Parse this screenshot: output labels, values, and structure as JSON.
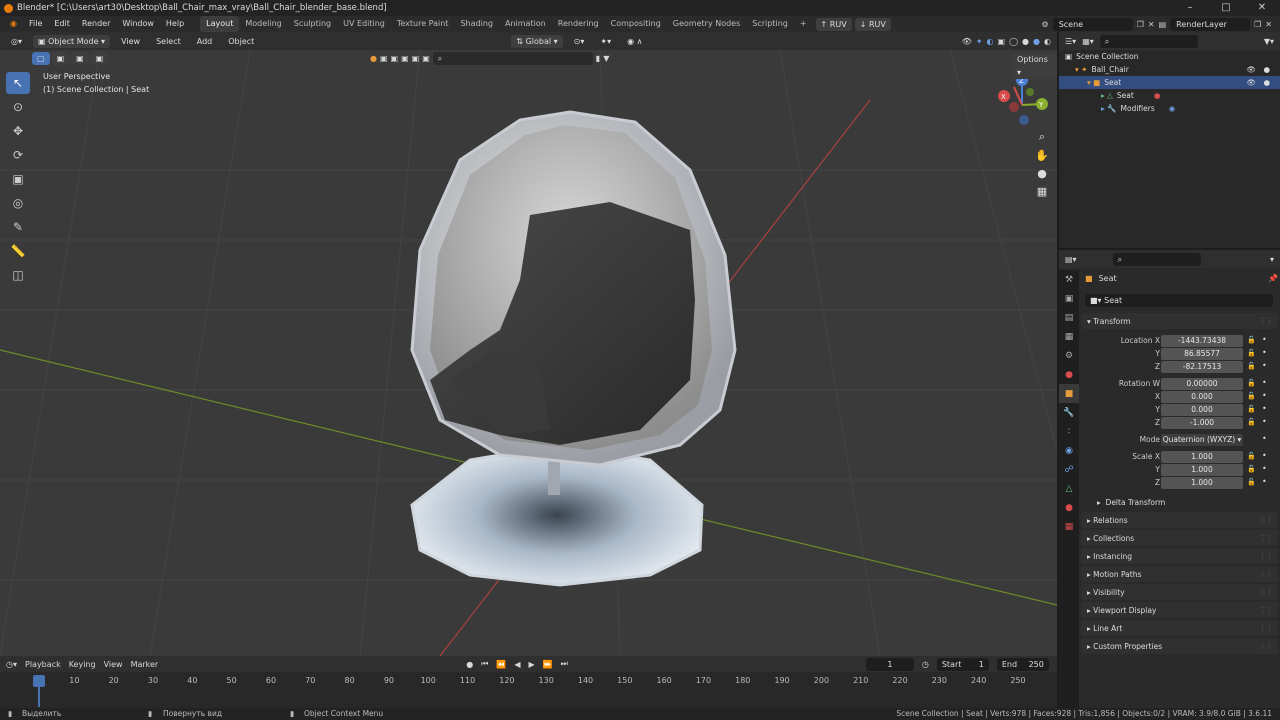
{
  "title": "Blender* [C:\\Users\\art30\\Desktop\\Ball_Chair_max_vray\\Ball_Chair_blender_base.blend]",
  "menu": [
    "File",
    "Edit",
    "Render",
    "Window",
    "Help"
  ],
  "workspaces": [
    "Layout",
    "Modeling",
    "Sculpting",
    "UV Editing",
    "Texture Paint",
    "Shading",
    "Animation",
    "Rendering",
    "Compositing",
    "Geometry Nodes",
    "Scripting"
  ],
  "ruv_buttons": [
    "RUV",
    "RUV"
  ],
  "scene": "Scene",
  "render_layer": "RenderLayer",
  "viewport_header": {
    "mode": "Object Mode",
    "menus": [
      "View",
      "Select",
      "Add",
      "Object"
    ],
    "orientation": "Global",
    "options": "Options"
  },
  "viewport": {
    "perspective": "User Perspective",
    "collection_info": "(1) Scene Collection | Seat"
  },
  "gizmo": {
    "x": "X",
    "y": "Y",
    "z": "Z"
  },
  "outliner": {
    "root": "Scene Collection",
    "items": [
      "Ball_Chair",
      "Seat",
      "Seat",
      "Modifiers"
    ]
  },
  "properties": {
    "object_name": "Seat",
    "data_name": "Seat",
    "section": "Transform",
    "location": {
      "label": "Location X",
      "x": "-1443.73438",
      "y": "86.85577",
      "z": "-82.17513"
    },
    "rotation": {
      "label": "Rotation W",
      "w": "0.00000",
      "x": "0.000",
      "y": "0.000",
      "z": "-1.000"
    },
    "mode": {
      "label": "Mode",
      "value": "Quaternion (WXYZ)"
    },
    "scale": {
      "label": "Scale X",
      "x": "1.000",
      "y": "1.000",
      "z": "1.000"
    },
    "axis_labels": {
      "y": "Y",
      "z": "Z",
      "x": "X"
    },
    "delta": "Delta Transform",
    "panels": [
      "Relations",
      "Collections",
      "Instancing",
      "Motion Paths",
      "Visibility",
      "Viewport Display",
      "Line Art",
      "Custom Properties"
    ]
  },
  "timeline": {
    "menus": [
      "Playback",
      "Keying",
      "View",
      "Marker"
    ],
    "current": "1",
    "start_label": "Start",
    "start": "1",
    "end_label": "End",
    "end": "250",
    "ticks": [
      "1",
      "10",
      "20",
      "30",
      "40",
      "50",
      "60",
      "70",
      "80",
      "90",
      "100",
      "110",
      "120",
      "130",
      "140",
      "150",
      "160",
      "170",
      "180",
      "190",
      "200",
      "210",
      "220",
      "230",
      "240",
      "250"
    ]
  },
  "status": {
    "left": "Выделить",
    "mid1": "Повернуть вид",
    "mid2": "Object Context Menu",
    "right": "Scene Collection | Seat | Verts:978 | Faces:928 | Tris:1,856 | Objects:0/2 | VRAM: 3.9/8.0 GiB | 3.6.11"
  },
  "colors": {
    "accent": "#4772b3",
    "orange": "#e87d0d",
    "xaxis": "#d84c4c",
    "yaxis": "#88b02d"
  }
}
